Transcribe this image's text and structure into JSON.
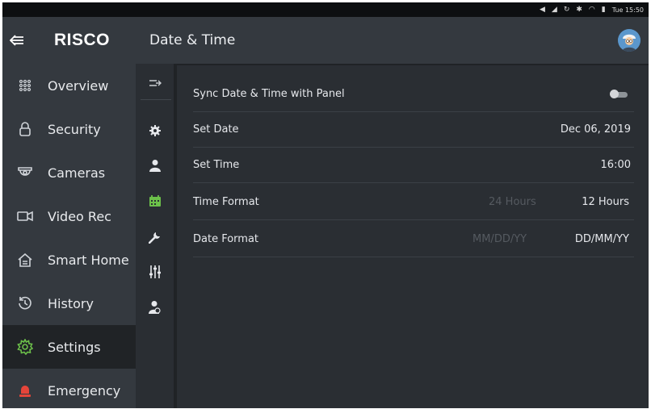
{
  "status_bar": {
    "time": "Tue 15:50"
  },
  "sidebar": {
    "logo": "RISCO",
    "items": [
      {
        "label": "Overview",
        "icon": "grid-icon"
      },
      {
        "label": "Security",
        "icon": "lock-icon"
      },
      {
        "label": "Cameras",
        "icon": "camera-icon"
      },
      {
        "label": "Video Rec",
        "icon": "video-icon"
      },
      {
        "label": "Smart Home",
        "icon": "home-icon"
      },
      {
        "label": "History",
        "icon": "history-icon"
      },
      {
        "label": "Settings",
        "icon": "gear-icon",
        "active": true
      },
      {
        "label": "Emergency",
        "icon": "siren-icon"
      }
    ]
  },
  "header": {
    "title": "Date & Time"
  },
  "settings": {
    "sync": {
      "label": "Sync Date & Time with Panel",
      "enabled": false
    },
    "set_date": {
      "label": "Set Date",
      "value": "Dec 06, 2019"
    },
    "set_time": {
      "label": "Set Time",
      "value": "16:00"
    },
    "time_format": {
      "label": "Time Format",
      "options": [
        "24 Hours",
        "12 Hours"
      ],
      "selected": "12 Hours"
    },
    "date_format": {
      "label": "Date Format",
      "options": [
        "MM/DD/YY",
        "DD/MM/YY"
      ],
      "selected": "DD/MM/YY"
    }
  },
  "colors": {
    "accent": "#6cc04a",
    "sidebar": "#34393f",
    "background": "#202326",
    "panel": "#2a2e33",
    "emergency": "#e5453a"
  }
}
